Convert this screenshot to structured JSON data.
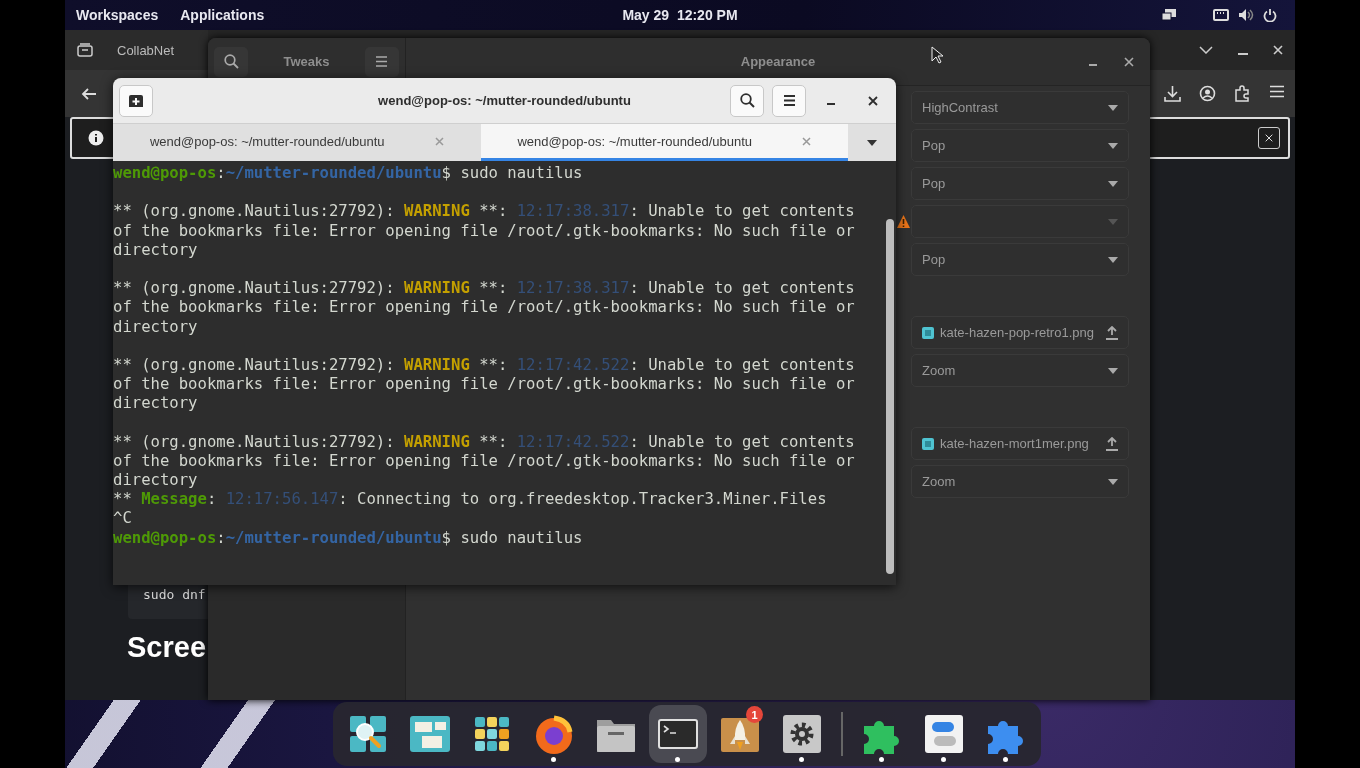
{
  "top_bar": {
    "menus": [
      "Workspaces",
      "Applications"
    ],
    "clock": "May 29  12:20 PM"
  },
  "browser_window": {
    "tab": "CollabNet",
    "code": "sudo dnf",
    "heading": "Scree"
  },
  "tweaks_window": {
    "title": "Tweaks",
    "page_title": "Appearance",
    "groups": [
      {
        "items": [
          {
            "kind": "dropdown",
            "value": "HighContrast",
            "warning": false
          },
          {
            "kind": "dropdown",
            "value": "Pop",
            "warning": false
          },
          {
            "kind": "dropdown",
            "value": "Pop",
            "warning": false
          },
          {
            "kind": "dropdown",
            "warning": true
          },
          {
            "kind": "dropdown",
            "value": "Pop",
            "warning": false
          }
        ]
      },
      {
        "items": [
          {
            "kind": "file",
            "value": "kate-hazen-pop-retro1.png",
            "warning": false
          },
          {
            "kind": "dropdown",
            "value": "Zoom",
            "warning": false
          }
        ]
      },
      {
        "items": [
          {
            "kind": "file",
            "value": "kate-hazen-mort1mer.png",
            "warning": false
          },
          {
            "kind": "dropdown",
            "value": "Zoom",
            "warning": false
          }
        ]
      }
    ]
  },
  "terminal_window": {
    "title": "wend@pop-os: ~/mutter-rounded/ubuntu",
    "tabs": [
      {
        "label": "wend@pop-os: ~/mutter-rounded/ubuntu",
        "selected": false
      },
      {
        "label": "wend@pop-os: ~/mutter-rounded/ubuntu",
        "selected": true
      }
    ],
    "lines": [
      {
        "kind": "text",
        "segments": [
          {
            "kind": "user",
            "text": "wend@pop-os"
          },
          {
            "kind": "plain",
            "text": ":"
          },
          {
            "kind": "path",
            "text": "~/mutter-rounded/ubuntu"
          },
          {
            "kind": "plain",
            "text": "$ sudo nautilus"
          }
        ]
      },
      {
        "kind": "blank"
      },
      {
        "kind": "text",
        "segments": [
          {
            "kind": "plain",
            "text": "** (org.gnome.Nautilus:27792): "
          },
          {
            "kind": "warning",
            "text": "WARNING"
          },
          {
            "kind": "plain",
            "text": " **: "
          },
          {
            "kind": "time",
            "text": "12:17:38.317"
          },
          {
            "kind": "plain",
            "text": ": Unable to get contents"
          }
        ]
      },
      {
        "kind": "text",
        "segments": [
          {
            "kind": "plain",
            "text": "of the bookmarks file: Error opening file /root/.gtk-bookmarks: No such file or"
          }
        ]
      },
      {
        "kind": "text",
        "segments": [
          {
            "kind": "plain",
            "text": "directory"
          }
        ]
      },
      {
        "kind": "blank"
      },
      {
        "kind": "text",
        "segments": [
          {
            "kind": "plain",
            "text": "** (org.gnome.Nautilus:27792): "
          },
          {
            "kind": "warning",
            "text": "WARNING"
          },
          {
            "kind": "plain",
            "text": " **: "
          },
          {
            "kind": "time",
            "text": "12:17:38.317"
          },
          {
            "kind": "plain",
            "text": ": Unable to get contents"
          }
        ]
      },
      {
        "kind": "text",
        "segments": [
          {
            "kind": "plain",
            "text": "of the bookmarks file: Error opening file /root/.gtk-bookmarks: No such file or"
          }
        ]
      },
      {
        "kind": "text",
        "segments": [
          {
            "kind": "plain",
            "text": "directory"
          }
        ]
      },
      {
        "kind": "blank"
      },
      {
        "kind": "text",
        "segments": [
          {
            "kind": "plain",
            "text": "** (org.gnome.Nautilus:27792): "
          },
          {
            "kind": "warning",
            "text": "WARNING"
          },
          {
            "kind": "plain",
            "text": " **: "
          },
          {
            "kind": "time",
            "text": "12:17:42.522"
          },
          {
            "kind": "plain",
            "text": ": Unable to get contents"
          }
        ]
      },
      {
        "kind": "text",
        "segments": [
          {
            "kind": "plain",
            "text": "of the bookmarks file: Error opening file /root/.gtk-bookmarks: No such file or"
          }
        ]
      },
      {
        "kind": "text",
        "segments": [
          {
            "kind": "plain",
            "text": "directory"
          }
        ]
      },
      {
        "kind": "blank"
      },
      {
        "kind": "text",
        "segments": [
          {
            "kind": "plain",
            "text": "** (org.gnome.Nautilus:27792): "
          },
          {
            "kind": "warning",
            "text": "WARNING"
          },
          {
            "kind": "plain",
            "text": " **: "
          },
          {
            "kind": "time",
            "text": "12:17:42.522"
          },
          {
            "kind": "plain",
            "text": ": Unable to get contents"
          }
        ]
      },
      {
        "kind": "text",
        "segments": [
          {
            "kind": "plain",
            "text": "of the bookmarks file: Error opening file /root/.gtk-bookmarks: No such file or"
          }
        ]
      },
      {
        "kind": "text",
        "segments": [
          {
            "kind": "plain",
            "text": "directory"
          }
        ]
      },
      {
        "kind": "text",
        "segments": [
          {
            "kind": "plain",
            "text": "** "
          },
          {
            "kind": "message",
            "text": "Message"
          },
          {
            "kind": "plain",
            "text": ": "
          },
          {
            "kind": "time",
            "text": "12:17:56.147"
          },
          {
            "kind": "plain",
            "text": ": Connecting to org.freedesktop.Tracker3.Miner.Files"
          }
        ]
      },
      {
        "kind": "text",
        "segments": [
          {
            "kind": "plain",
            "text": "^C"
          }
        ]
      },
      {
        "kind": "text",
        "segments": [
          {
            "kind": "user",
            "text": "wend@pop-os"
          },
          {
            "kind": "plain",
            "text": ":"
          },
          {
            "kind": "path",
            "text": "~/mutter-rounded/ubuntu"
          },
          {
            "kind": "plain",
            "text": "$ sudo nautilus"
          }
        ]
      }
    ]
  },
  "dock": {
    "items": [
      {
        "kind": "search",
        "running": false,
        "active": false
      },
      {
        "kind": "windows",
        "running": false,
        "active": false
      },
      {
        "kind": "grid",
        "running": false,
        "active": false
      },
      {
        "kind": "browser",
        "running": true,
        "active": false
      },
      {
        "kind": "folder",
        "running": false,
        "active": false
      },
      {
        "kind": "terminal",
        "running": true,
        "active": true
      },
      {
        "kind": "rocket",
        "running": false,
        "active": false,
        "badge": "1"
      },
      {
        "kind": "settings",
        "running": true,
        "active": false
      },
      {
        "kind": "divider"
      },
      {
        "kind": "puzzle_green",
        "running": true,
        "active": false
      },
      {
        "kind": "toggles",
        "running": true,
        "active": false
      },
      {
        "kind": "puzzle_blue",
        "running": true,
        "active": false
      }
    ]
  }
}
